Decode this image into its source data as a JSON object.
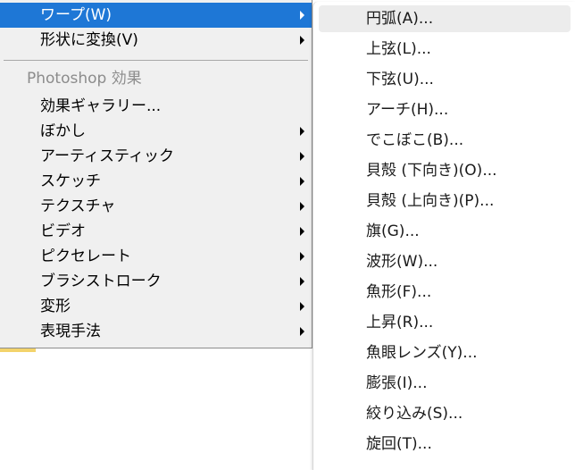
{
  "main_menu": {
    "items_top": [
      {
        "label": "ワープ(W)",
        "has_submenu": true,
        "active": true
      },
      {
        "label": "形状に変換(V)",
        "has_submenu": true
      }
    ],
    "group_heading": "Photoshop 効果",
    "items_effects": [
      {
        "label": "効果ギャラリー...",
        "has_submenu": false
      },
      {
        "label": "ぼかし",
        "has_submenu": true
      },
      {
        "label": "アーティスティック",
        "has_submenu": true
      },
      {
        "label": "スケッチ",
        "has_submenu": true
      },
      {
        "label": "テクスチャ",
        "has_submenu": true
      },
      {
        "label": "ビデオ",
        "has_submenu": true
      },
      {
        "label": "ピクセレート",
        "has_submenu": true
      },
      {
        "label": "ブラシストローク",
        "has_submenu": true
      },
      {
        "label": "変形",
        "has_submenu": true
      },
      {
        "label": "表現手法",
        "has_submenu": true
      }
    ]
  },
  "submenu": {
    "items": [
      {
        "label": "円弧(A)...",
        "hover": true
      },
      {
        "label": "上弦(L)..."
      },
      {
        "label": "下弦(U)..."
      },
      {
        "label": "アーチ(H)..."
      },
      {
        "label": "でこぼこ(B)..."
      },
      {
        "label": "貝殻 (下向き)(O)..."
      },
      {
        "label": "貝殻 (上向き)(P)..."
      },
      {
        "label": "旗(G)..."
      },
      {
        "label": "波形(W)..."
      },
      {
        "label": "魚形(F)..."
      },
      {
        "label": "上昇(R)..."
      },
      {
        "label": "魚眼レンズ(Y)..."
      },
      {
        "label": "膨張(I)..."
      },
      {
        "label": "絞り込み(S)..."
      },
      {
        "label": "旋回(T)..."
      }
    ]
  },
  "colors": {
    "active_highlight": "#1e77d6",
    "menu_background": "#f0f0f0",
    "submenu_background": "#ffffff",
    "disabled_text": "#8c8c8c"
  },
  "icons": {
    "submenu_arrow": "chevron-right-icon"
  }
}
